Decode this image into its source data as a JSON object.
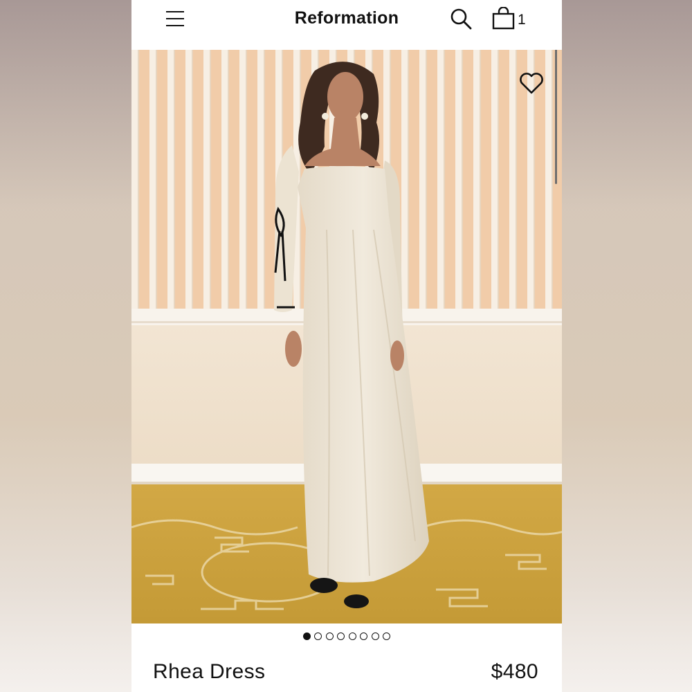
{
  "header": {
    "brand": "Reformation",
    "bag_count": "1",
    "icons": [
      "menu-icon",
      "search-icon",
      "bag-icon"
    ]
  },
  "hero": {
    "alt": "Model wearing cream long-sleeve maxi dress with black ribbon ties",
    "favorite_icon": "heart-icon",
    "image_index": 1,
    "image_count": 8
  },
  "product": {
    "name": "Rhea Dress",
    "price": "$480"
  },
  "colors": {
    "text": "#111111",
    "background": "#ffffff",
    "dress": "#ece4d4",
    "wall_stripe": "#f0c9a6",
    "carpet": "#c9a23c"
  }
}
